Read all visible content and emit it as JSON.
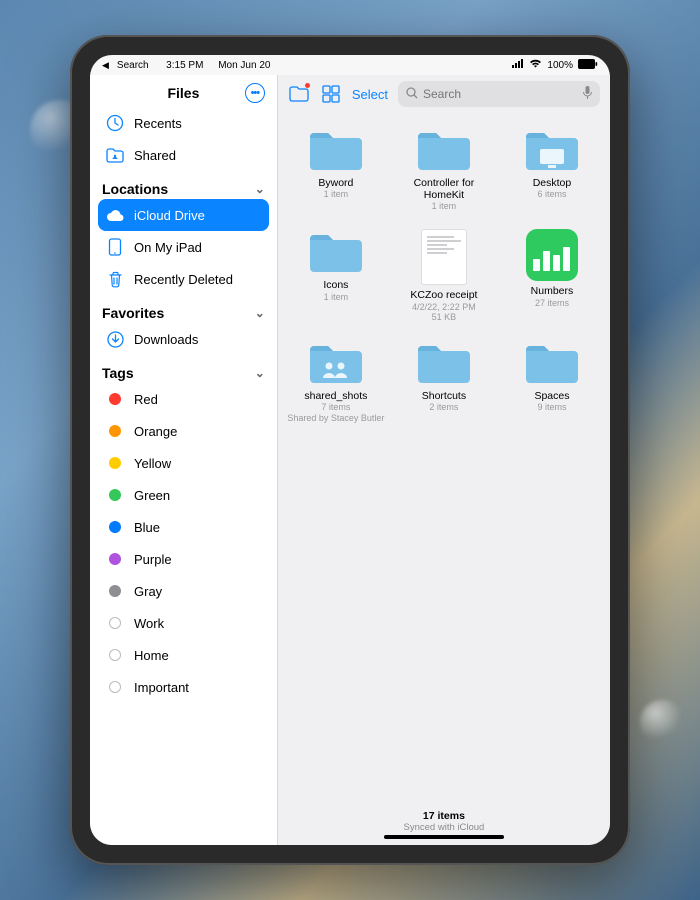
{
  "status": {
    "back_label": "Search",
    "time": "3:15 PM",
    "date": "Mon Jun 20",
    "battery_pct": "100%"
  },
  "sidebar": {
    "title": "Files",
    "top": [
      {
        "icon": "clock-icon",
        "label": "Recents"
      },
      {
        "icon": "shared-folder-icon",
        "label": "Shared"
      }
    ],
    "locations_head": "Locations",
    "locations": [
      {
        "icon": "icloud-icon",
        "label": "iCloud Drive",
        "selected": true
      },
      {
        "icon": "ipad-icon",
        "label": "On My iPad"
      },
      {
        "icon": "trash-icon",
        "label": "Recently Deleted"
      }
    ],
    "favorites_head": "Favorites",
    "favorites": [
      {
        "icon": "download-icon",
        "label": "Downloads"
      }
    ],
    "tags_head": "Tags",
    "tags": [
      {
        "label": "Red",
        "color": "#ff3b30"
      },
      {
        "label": "Orange",
        "color": "#ff9500"
      },
      {
        "label": "Yellow",
        "color": "#ffcc00"
      },
      {
        "label": "Green",
        "color": "#34c759"
      },
      {
        "label": "Blue",
        "color": "#007aff"
      },
      {
        "label": "Purple",
        "color": "#af52de"
      },
      {
        "label": "Gray",
        "color": "#8e8e93"
      },
      {
        "label": "Work",
        "hollow": true
      },
      {
        "label": "Home",
        "hollow": true
      },
      {
        "label": "Important",
        "hollow": true
      }
    ]
  },
  "toolbar": {
    "select_label": "Select",
    "search_placeholder": "Search"
  },
  "items": [
    {
      "type": "folder",
      "name": "Byword",
      "meta": "1 item"
    },
    {
      "type": "folder",
      "name": "Controller for HomeKit",
      "meta": "1 item"
    },
    {
      "type": "folder-desktop",
      "name": "Desktop",
      "meta": "6 items"
    },
    {
      "type": "folder",
      "name": "Icons",
      "meta": "1 item"
    },
    {
      "type": "doc",
      "name": "KCZoo receipt",
      "meta": "4/2/22, 2:22 PM",
      "meta2": "51 KB"
    },
    {
      "type": "app-numbers",
      "name": "Numbers",
      "meta": "27 items"
    },
    {
      "type": "folder-shared",
      "name": "shared_shots",
      "meta": "7 items",
      "meta2": "Shared by Stacey Butler"
    },
    {
      "type": "folder",
      "name": "Shortcuts",
      "meta": "2 items"
    },
    {
      "type": "folder",
      "name": "Spaces",
      "meta": "9 items"
    }
  ],
  "footer": {
    "count": "17 items",
    "status": "Synced with iCloud"
  }
}
